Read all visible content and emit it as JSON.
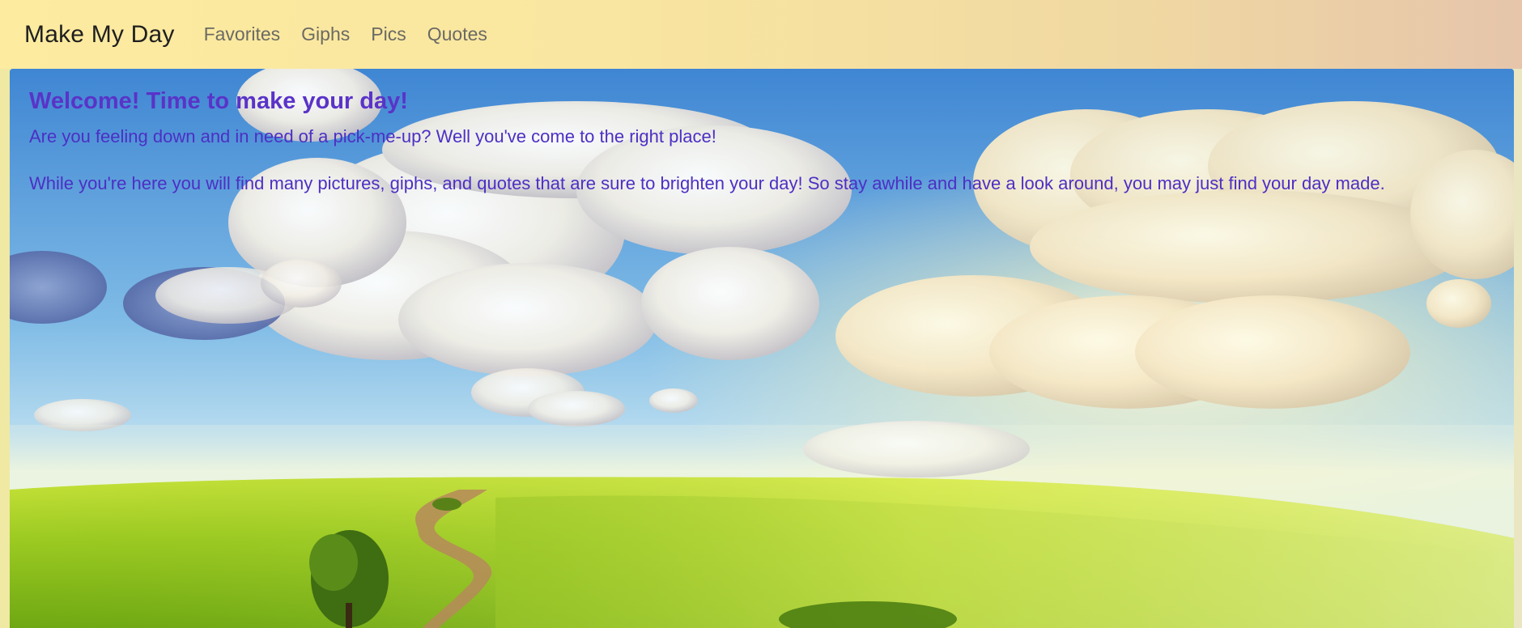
{
  "navbar": {
    "brand": "Make My Day",
    "links": [
      "Favorites",
      "Giphs",
      "Pics",
      "Quotes"
    ]
  },
  "hero": {
    "title": "Welcome! Time to make your day!",
    "paragraph1": "Are you feeling down and in need of a pick-me-up? Well you've come to the right place!",
    "paragraph2": "While you're here you will find many pictures, giphs, and quotes that are sure to brighten your day! So stay awhile and have a look around, you may just find your day made."
  },
  "colors": {
    "navbar_left": "#fdeba0",
    "navbar_right": "#e6c5ab",
    "hero_text": "#5a33c8",
    "brand_text": "#1f1f1f",
    "nav_link": "#6b6a63"
  }
}
